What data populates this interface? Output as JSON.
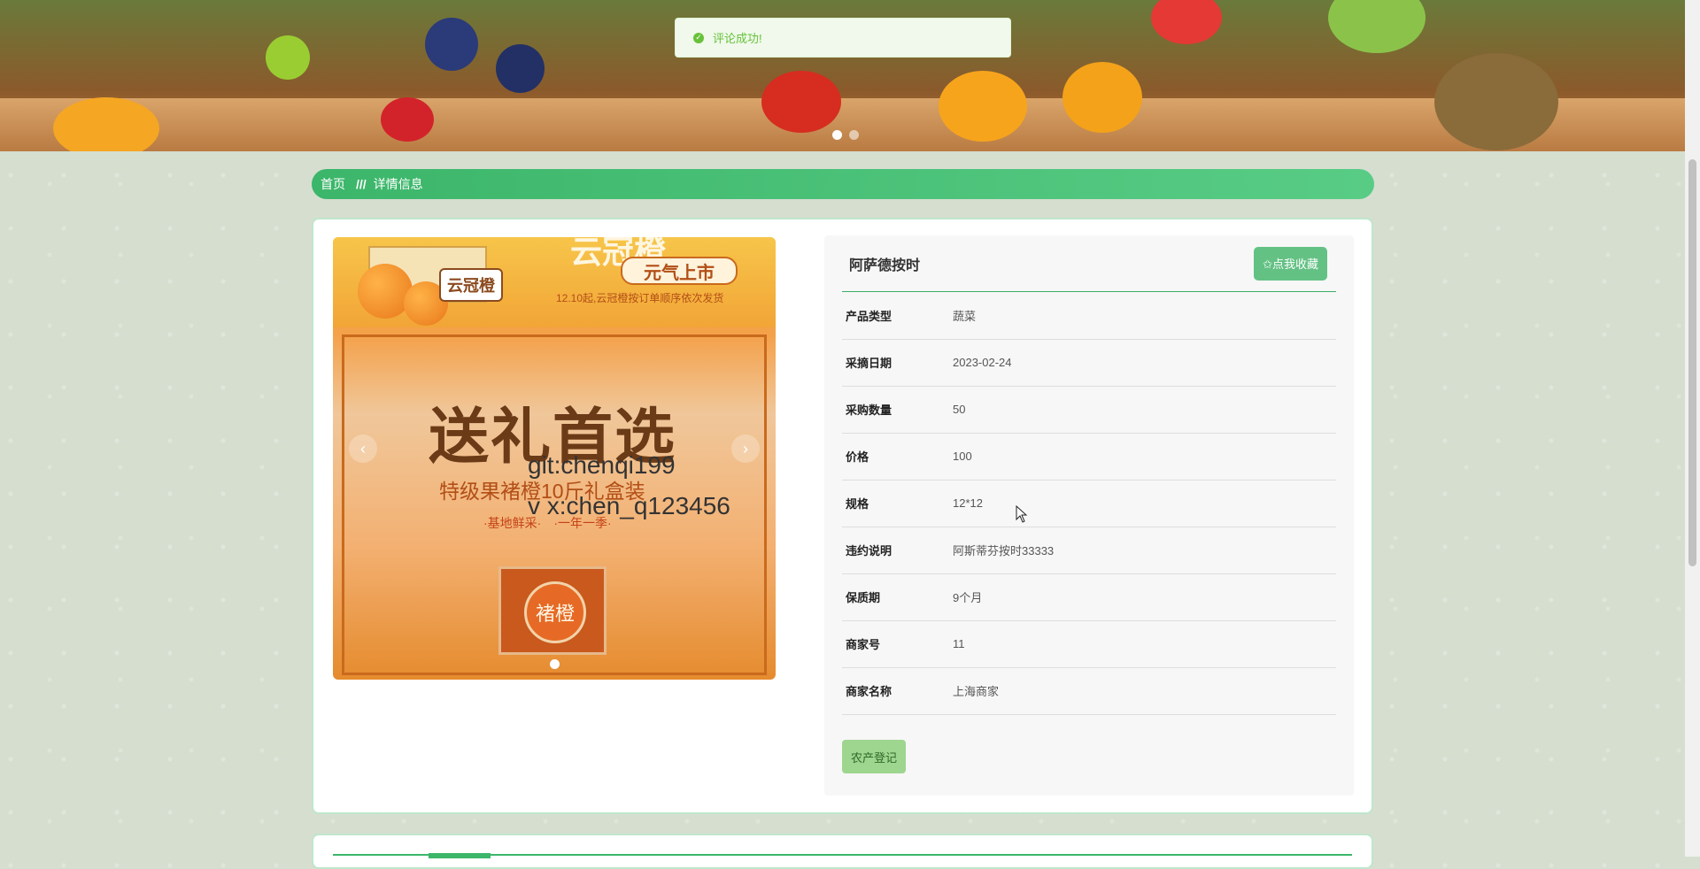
{
  "toast": {
    "icon": "check-circle-icon",
    "message": "评论成功!"
  },
  "banner": {
    "slide_count": 2,
    "active_slide": 1
  },
  "breadcrumb": {
    "home": "首页",
    "separator": "///",
    "current": "详情信息"
  },
  "gallery": {
    "headline": "云冠橙",
    "tag": "元气上市",
    "package_label": "云冠橙",
    "date_note": "12.10起,云冠橙按订单顺序依次发货",
    "slogan": "送礼首选",
    "subtitle": "特级果褚橙10斤礼盒装",
    "subtitle2": "·基地鲜采·　·一年一季·",
    "box_label": "褚橙",
    "watermark1": "git:chenqi199",
    "watermark2": "v x:chen_q123456",
    "prev_icon": "chevron-left-icon",
    "next_icon": "chevron-right-icon"
  },
  "product": {
    "name": "阿萨德按时",
    "favorite_label": "✩点我收藏",
    "fields": [
      {
        "label": "产品类型",
        "value": "蔬菜"
      },
      {
        "label": "采摘日期",
        "value": "2023-02-24"
      },
      {
        "label": "采购数量",
        "value": "50"
      },
      {
        "label": "价格",
        "value": "100"
      },
      {
        "label": "规格",
        "value": "12*12"
      },
      {
        "label": "违约说明",
        "value": "阿斯蒂芬按时33333"
      },
      {
        "label": "保质期",
        "value": "9个月"
      },
      {
        "label": "商家号",
        "value": "11"
      },
      {
        "label": "商家名称",
        "value": "上海商家"
      }
    ],
    "register_label": "农产登记"
  },
  "colors": {
    "accent": "#3cb66a",
    "toast_text": "#67c23a",
    "register_bg": "#9ed58f"
  }
}
